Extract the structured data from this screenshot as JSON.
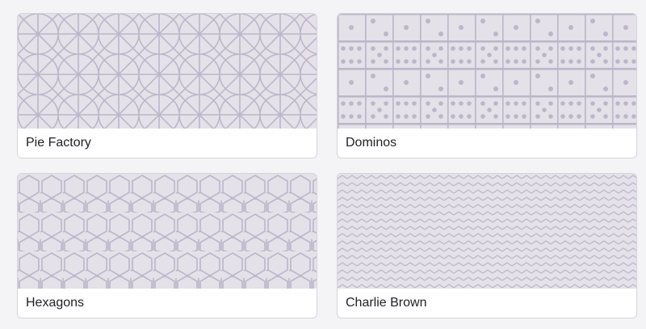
{
  "colors": {
    "page_background": "#f4f3f6",
    "pattern_background": "#e4e1e9",
    "pattern_line": "#bdb6ca",
    "card_border": "#d7d5dc"
  },
  "patterns": [
    {
      "name": "Pie Factory",
      "style": "pie-factory"
    },
    {
      "name": "Dominos",
      "style": "dominos"
    },
    {
      "name": "Hexagons",
      "style": "hexagons"
    },
    {
      "name": "Charlie Brown",
      "style": "charlie-brown"
    }
  ]
}
